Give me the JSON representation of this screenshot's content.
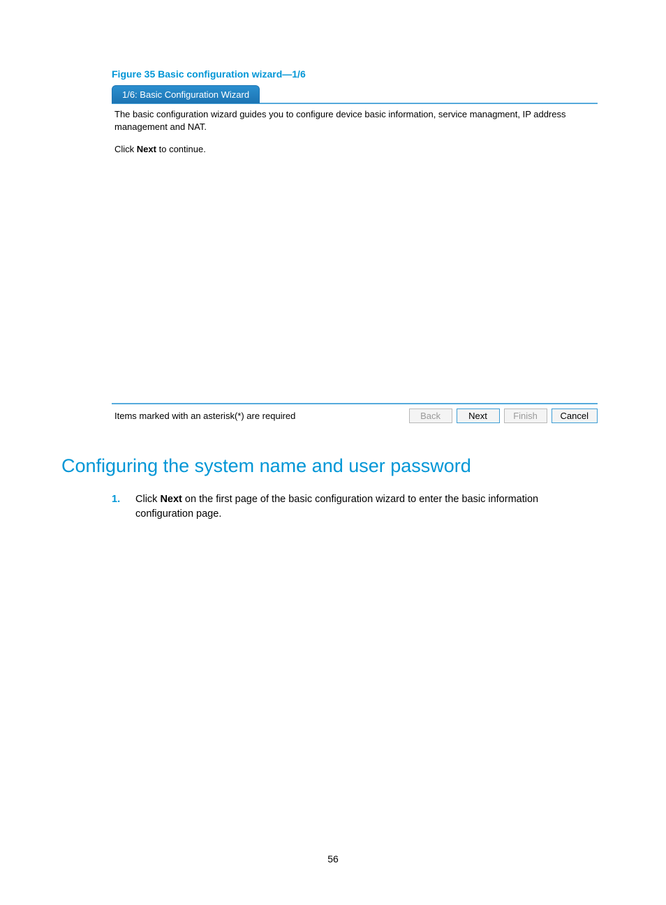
{
  "figure_caption": "Figure 35 Basic configuration wizard—1/6",
  "wizard": {
    "tab_title": "1/6: Basic Configuration Wizard",
    "intro": "The basic configuration wizard guides you to configure device basic information, service managment, IP address management and NAT.",
    "continue_prefix": "Click",
    "continue_bold": "Next",
    "continue_suffix": "to continue.",
    "footer_note": "Items marked with an asterisk(*) are required",
    "buttons": {
      "back": "Back",
      "next": "Next",
      "finish": "Finish",
      "cancel": "Cancel"
    }
  },
  "section_heading": "Configuring the system name and user password",
  "steps": [
    {
      "num": "1.",
      "pre": "Click ",
      "bold": "Next",
      "post": " on the first page of the basic configuration wizard to enter the basic information configuration page."
    }
  ],
  "page_number": "56"
}
